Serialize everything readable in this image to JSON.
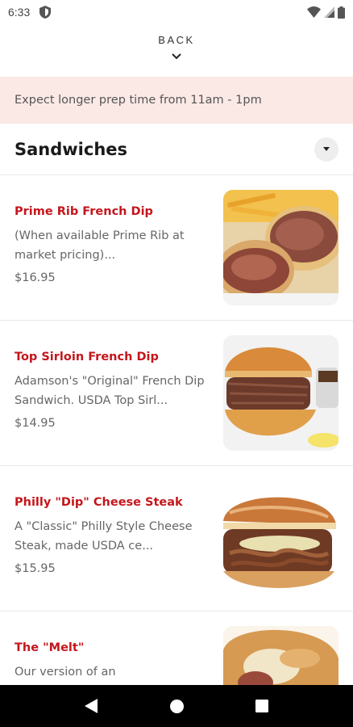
{
  "status_bar": {
    "time": "6:33",
    "icons": [
      "shield-icon",
      "wifi-icon",
      "signal-icon",
      "battery-icon"
    ]
  },
  "back": {
    "label": "BACK",
    "icon": "chevron-down-icon"
  },
  "banner": {
    "text": "Expect longer prep time from 11am - 1pm",
    "background": "#fbe9e6"
  },
  "section": {
    "title": "Sandwiches",
    "toggle_icon": "caret-down-icon"
  },
  "items": [
    {
      "name": "Prime Rib French Dip",
      "description": "(When available Prime Rib at market pricing)...",
      "price": "$16.95"
    },
    {
      "name": "Top Sirloin French Dip",
      "description": "Adamson's \"Original\" French Dip Sandwich. USDA Top Sirl...",
      "price": "$14.95"
    },
    {
      "name": "Philly \"Dip\" Cheese Steak",
      "description": "A \"Classic\" Philly Style Cheese Steak, made USDA ce...",
      "price": "$15.95"
    },
    {
      "name": "The \"Melt\"",
      "description": "Our version of an",
      "price": ""
    }
  ],
  "colors": {
    "item_name": "#c4161c",
    "nav_bar": "#000000"
  },
  "nav_bar": {
    "buttons": [
      "back-triangle-icon",
      "home-circle-icon",
      "recents-square-icon"
    ]
  }
}
